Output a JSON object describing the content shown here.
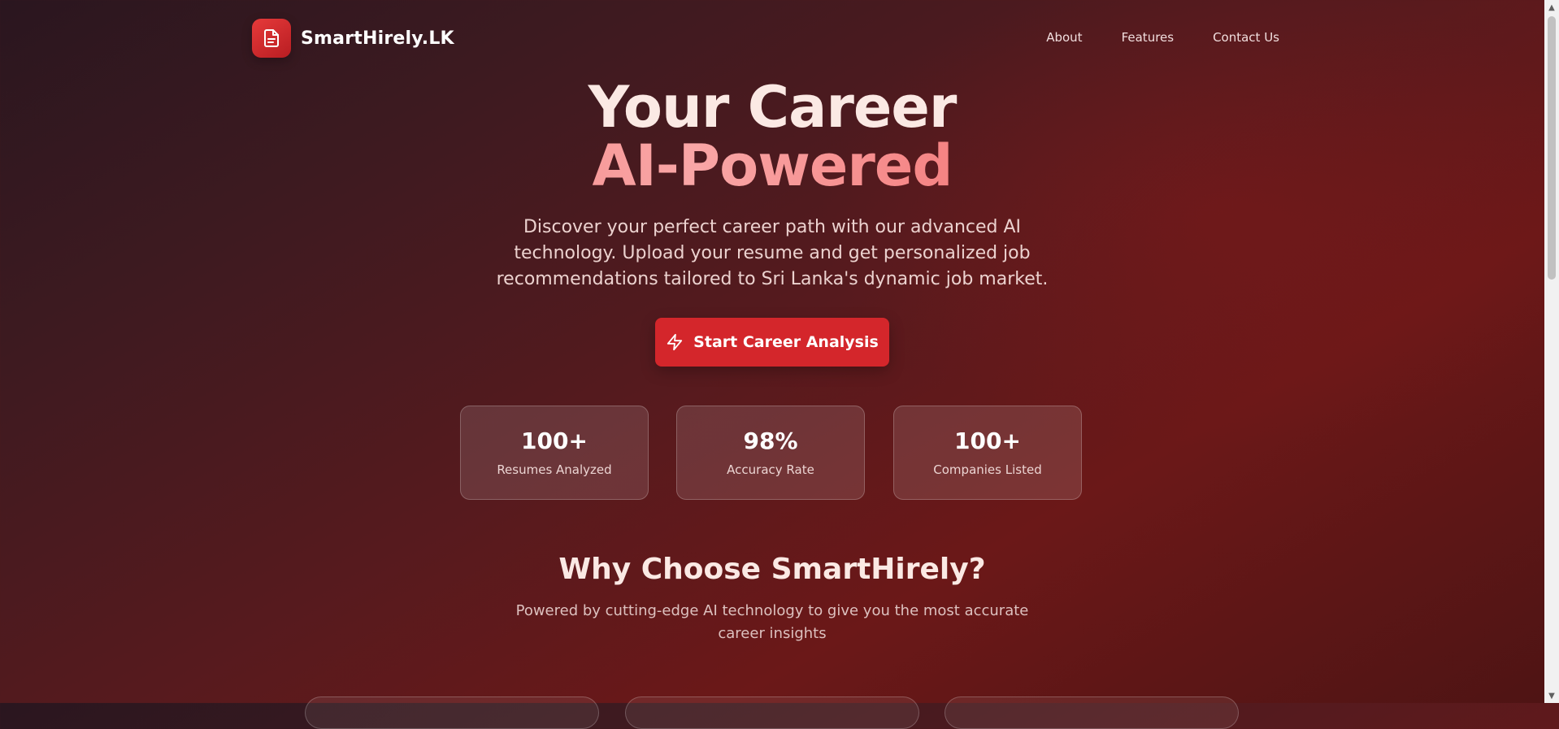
{
  "header": {
    "brand": "SmartHirely.LK",
    "logo_icon": "document-icon",
    "nav": [
      {
        "label": "About"
      },
      {
        "label": "Features"
      },
      {
        "label": "Contact Us"
      }
    ]
  },
  "hero": {
    "title_line1": "Your Career",
    "title_line2": "AI-Powered",
    "description": "Discover your perfect career path with our advanced AI technology. Upload your resume and get personalized job recommendations tailored to Sri Lanka's dynamic job market.",
    "cta_label": "Start Career Analysis",
    "cta_icon": "lightning-icon"
  },
  "stats": [
    {
      "value": "100+",
      "label": "Resumes Analyzed"
    },
    {
      "value": "98%",
      "label": "Accuracy Rate"
    },
    {
      "value": "100+",
      "label": "Companies Listed"
    }
  ],
  "why": {
    "title": "Why Choose SmartHirely?",
    "description": "Powered by cutting-edge AI technology to give you the most accurate career insights"
  },
  "colors": {
    "accent": "#d4262b",
    "gradient_start": "#f25d5d",
    "gradient_mid": "#f9a6a6"
  }
}
